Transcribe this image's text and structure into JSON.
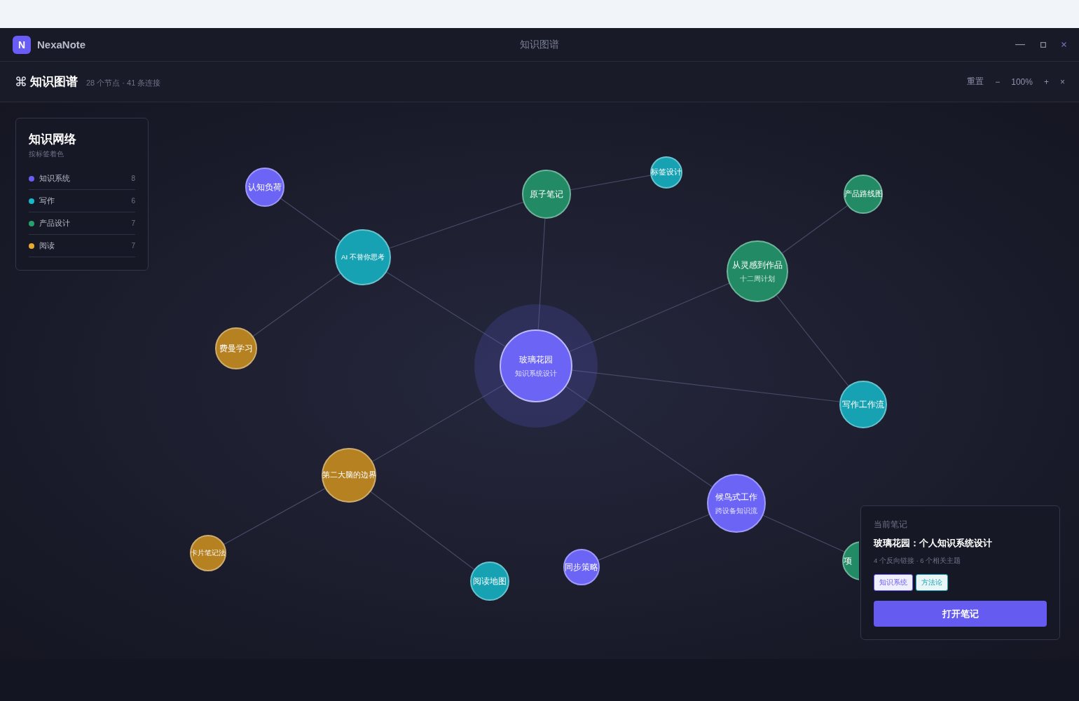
{
  "app": {
    "logo": "N",
    "name": "NexaNote"
  },
  "window": {
    "title": "知识图谱"
  },
  "toolbar": {
    "icon": "⌘",
    "title": "知识图谱",
    "stats": "28 个节点 · 41 条连接",
    "reset": "重置",
    "zoom_out": "−",
    "zoom": "100%",
    "zoom_in": "+",
    "close": "×"
  },
  "legend": {
    "title": "知识网络",
    "subtitle": "按标签着色",
    "items": [
      {
        "label": "知识系统",
        "count": "8",
        "color": "#6a5cf6"
      },
      {
        "label": "写作",
        "count": "6",
        "color": "#19b8c9"
      },
      {
        "label": "产品设计",
        "count": "7",
        "color": "#22a36c"
      },
      {
        "label": "阅读",
        "count": "7",
        "color": "#e9a930"
      }
    ]
  },
  "nodes": [
    {
      "label": "认知负荷",
      "color": "#6b64f5",
      "selected": false
    },
    {
      "label": "原子笔记",
      "color": "#228b65",
      "selected": false
    },
    {
      "label": "标签设计",
      "color": "#17a2b3",
      "selected": false
    },
    {
      "label": "产品路线图",
      "color": "#228b65",
      "selected": false
    },
    {
      "label": "AI 不替你思考",
      "color": "#17a2b3",
      "selected": false
    },
    {
      "label": "从灵感到作品",
      "sublabel": "十二周计划",
      "color": "#228b65",
      "selected": false
    },
    {
      "label": "费曼学习",
      "color": "#b58121",
      "selected": false
    },
    {
      "label": "玻璃花园",
      "sublabel": "知识系统设计",
      "color": "#6b64f5",
      "selected": true
    },
    {
      "label": "写作工作流",
      "color": "#17a2b3",
      "selected": false
    },
    {
      "label": "第二大脑的边界",
      "color": "#b58121",
      "selected": false
    },
    {
      "label": "候鸟式工作",
      "sublabel": "跨设备知识流",
      "color": "#6b64f5",
      "selected": false
    },
    {
      "label": "卡片笔记法",
      "color": "#b58121",
      "selected": false
    },
    {
      "label": "阅读地图",
      "color": "#17a2b3",
      "selected": false
    },
    {
      "label": "同步策略",
      "color": "#6b64f5",
      "selected": false
    },
    {
      "label": "项",
      "color": "#228b65",
      "selected": false
    }
  ],
  "note_card": {
    "heading": "当前笔记",
    "title": "玻璃花园：个人知识系统设计",
    "meta": "4 个反向链接 · 6 个相关主题",
    "tags": [
      {
        "label": "知识系统",
        "color": "#6a5cf6"
      },
      {
        "label": "方法论",
        "color": "#14a3b8"
      }
    ],
    "button": "打开笔记"
  }
}
